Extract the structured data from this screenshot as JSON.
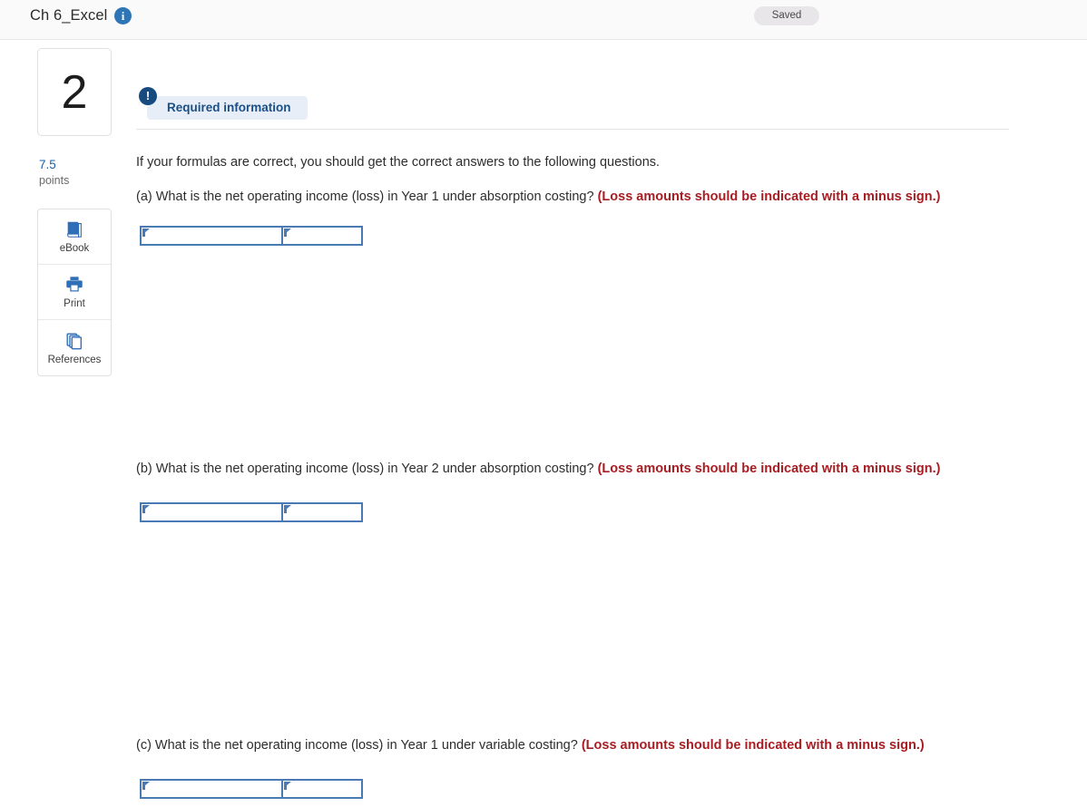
{
  "topbar": {
    "title": "Ch 6_Excel",
    "info_icon": "info-icon",
    "save_status": "Saved"
  },
  "rail": {
    "question_number": "2",
    "points_value": "7.5",
    "points_label": "points",
    "tools": [
      {
        "label": "eBook",
        "icon": "book-icon"
      },
      {
        "label": "Print",
        "icon": "printer-icon"
      },
      {
        "label": "References",
        "icon": "copy-icon"
      }
    ]
  },
  "main": {
    "required_badge": {
      "icon": "exclamation-icon",
      "label": "Required information"
    },
    "intro": "If your formulas are correct, you should get the correct answers to the following questions.",
    "questions": [
      {
        "prompt": "(a) What is the net operating income (loss) in Year 1 under absorption costing?",
        "note": "(Loss amounts should be indicated with a minus sign.)",
        "answer_cells": [
          "",
          ""
        ]
      },
      {
        "prompt": "(b) What is the net operating income (loss) in Year 2 under absorption costing?",
        "note": "(Loss amounts should be indicated with a minus sign.)",
        "answer_cells": [
          "",
          ""
        ]
      },
      {
        "prompt": "(c) What is the net operating income (loss) in Year 1 under variable costing?",
        "note": "(Loss amounts should be indicated with a minus sign.)",
        "answer_cells": [
          "",
          ""
        ]
      }
    ]
  },
  "colors": {
    "accent_blue": "#2e75b6",
    "badge_blue": "#174a7e",
    "badge_bg": "#e8eef7",
    "note_red": "#a81d22",
    "table_border": "#4a7ab4",
    "points_blue": "#1b5ea8"
  }
}
